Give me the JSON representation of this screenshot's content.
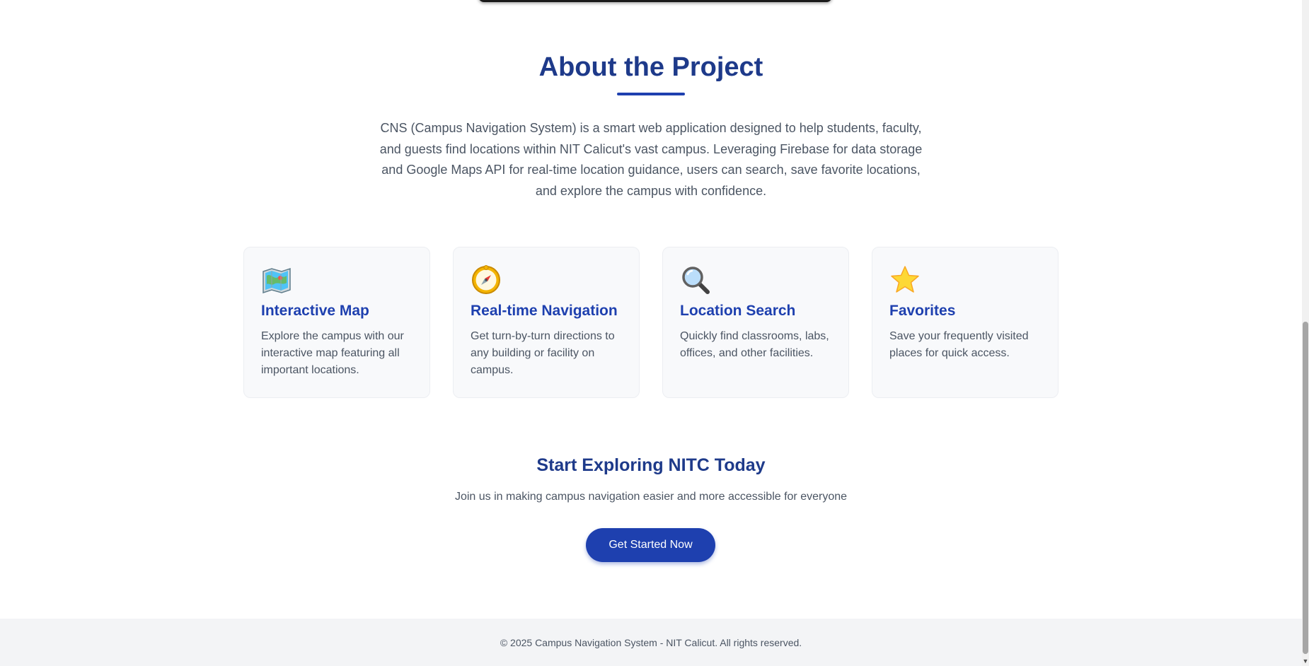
{
  "about": {
    "title": "About the Project",
    "description": "CNS (Campus Navigation System) is a smart web application designed to help students, faculty, and guests find locations within NIT Calicut's vast campus. Leveraging Firebase for data storage and Google Maps API for real-time location guidance, users can search, save favorite locations, and explore the campus with confidence.",
    "accent_color": "#1e3a8a"
  },
  "features": [
    {
      "icon": "map-icon",
      "title": "Interactive Map",
      "description": "Explore the campus with our interactive map featuring all important locations."
    },
    {
      "icon": "compass-icon",
      "title": "Real-time Navigation",
      "description": "Get turn-by-turn directions to any building or facility on campus."
    },
    {
      "icon": "magnifier-icon",
      "title": "Location Search",
      "description": "Quickly find classrooms, labs, offices, and other facilities."
    },
    {
      "icon": "star-icon",
      "title": "Favorites",
      "description": "Save your frequently visited places for quick access."
    }
  ],
  "cta": {
    "title": "Start Exploring NITC Today",
    "subtitle": "Join us in making campus navigation easier and more accessible for everyone",
    "button_label": "Get Started Now",
    "button_color": "#1e40af"
  },
  "footer": {
    "text": "© 2025 Campus Navigation System - NIT Calicut. All rights reserved."
  }
}
